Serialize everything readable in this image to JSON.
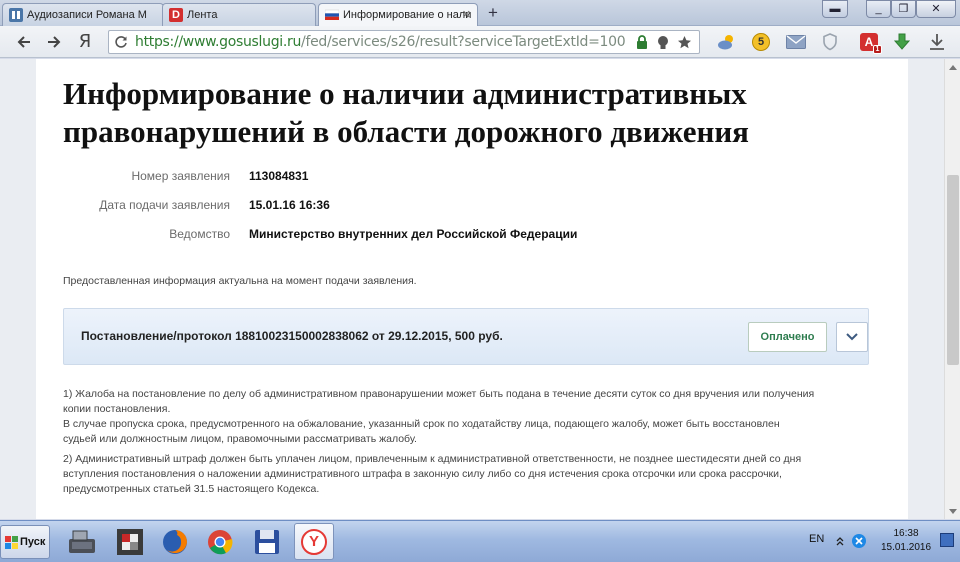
{
  "browser": {
    "tabs": [
      {
        "label": "Аудиозаписи Романа М"
      },
      {
        "label": "Лента"
      },
      {
        "label": "Информирование о нали"
      }
    ],
    "new_tab_label": "+",
    "favicon_lenta_letter": "D",
    "address": {
      "scheme": "https://",
      "host": "www.gosuslugi.ru",
      "path": "/fed/services/s26/result?serviceTargetExtId=100"
    },
    "logo_letter": "Я",
    "ext_badge_5": "5",
    "ext_badge_a": "A",
    "ext_badge_a_count": "1"
  },
  "page": {
    "title_line1": "Информирование о наличии административных",
    "title_line2": "правонарушений в области дорожного движения",
    "details": [
      {
        "label": "Номер заявления",
        "value": "113084831"
      },
      {
        "label": "Дата подачи заявления",
        "value": "15.01.16 16:36"
      },
      {
        "label": "Ведомство",
        "value": "Министерство внутренних дел Российской Федерации"
      }
    ],
    "note": "Предоставленная информация актуальна на момент подачи заявления.",
    "card": {
      "text": "Постановление/протокол 18810023150002838062 от 29.12.2015, 500 руб.",
      "status_button": "Оплачено"
    },
    "footnote1": [
      "1) Жалоба на постановление по делу об административном правонарушении может быть подана в течение десяти суток со дня вручения или получения",
      "копии постановления.",
      "В случае пропуска срока, предусмотренного на обжалование, указанный срок по ходатайству лица, подающего жалобу, может быть восстановлен",
      "судьей или должностным лицом, правомочными рассматривать жалобу."
    ],
    "footnote2": [
      "2) Административный штраф должен быть уплачен лицом, привлеченным к административной ответственности, не позднее шестидесяти дней со дня",
      "вступления постановления о наложении административного штрафа в законную силу либо со дня истечения срока отсрочки или срока рассрочки,",
      "предусмотренных статьей 31.5 настоящего Кодекса."
    ]
  },
  "taskbar": {
    "start_label": "Пуск",
    "yandex_letter": "Y",
    "lang": "EN",
    "time": "16:38",
    "date": "15.01.2016"
  },
  "colors": {
    "accent_green": "#2e7d4f",
    "url_green": "#2e7d32",
    "card_bg": "#e4edf8",
    "taskbar": "#9fb9e1"
  }
}
